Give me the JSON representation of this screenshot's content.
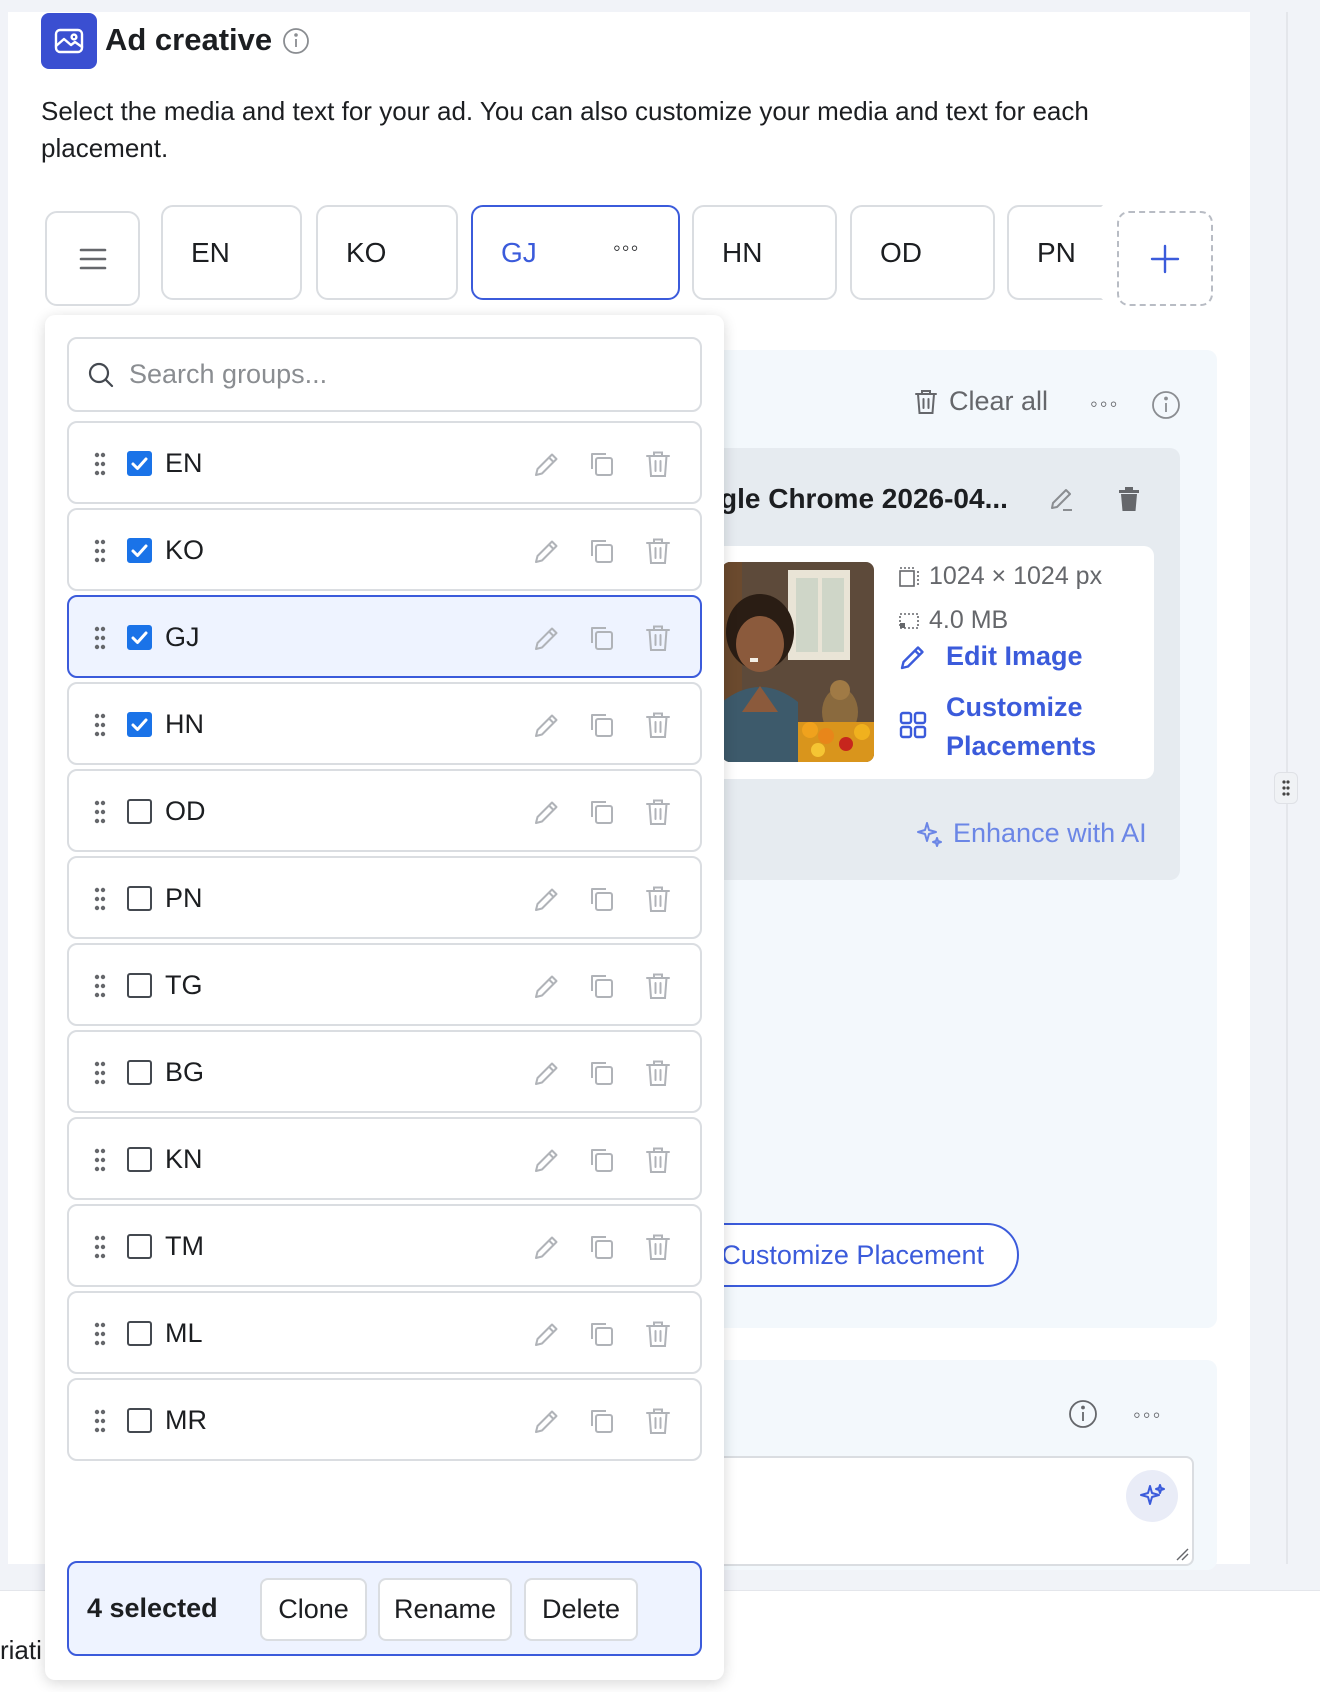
{
  "header": {
    "title": "Ad creative",
    "description": "Select the media and text for your ad. You can also customize your media and text for each placement."
  },
  "tabs": [
    {
      "label": "EN",
      "active": false
    },
    {
      "label": "KO",
      "active": false
    },
    {
      "label": "GJ",
      "active": true,
      "more": "◦◦◦"
    },
    {
      "label": "HN",
      "active": false
    },
    {
      "label": "OD",
      "active": false
    },
    {
      "label": "PN",
      "active": false
    }
  ],
  "dropdown": {
    "search_placeholder": "Search groups...",
    "groups": [
      {
        "label": "EN",
        "checked": true
      },
      {
        "label": "KO",
        "checked": true
      },
      {
        "label": "GJ",
        "checked": true,
        "active": true
      },
      {
        "label": "HN",
        "checked": true
      },
      {
        "label": "OD",
        "checked": false
      },
      {
        "label": "PN",
        "checked": false
      },
      {
        "label": "TG",
        "checked": false
      },
      {
        "label": "BG",
        "checked": false
      },
      {
        "label": "KN",
        "checked": false
      },
      {
        "label": "TM",
        "checked": false
      },
      {
        "label": "ML",
        "checked": false
      },
      {
        "label": "MR",
        "checked": false
      }
    ],
    "bulk": {
      "count": "4 selected",
      "clone": "Clone",
      "rename": "Rename",
      "delete": "Delete"
    }
  },
  "media_panel": {
    "clear_all": "Clear all",
    "more": "◦◦◦",
    "media_name": "gle Chrome 2026-04...",
    "dimensions": "1024 × 1024 px",
    "file_size": "4.0 MB",
    "edit_image": "Edit Image",
    "customize_placements": "Customize Placements",
    "enhance_ai": "Enhance with AI",
    "customize_placement_button": "Customize Placement"
  },
  "text_panel": {
    "more": "◦◦◦"
  },
  "footer": {
    "partial_text": "riati"
  },
  "colors": {
    "accent": "#3b5bdb",
    "checkbox": "#1a73e8",
    "icon_bg": "#3a4fd1"
  }
}
